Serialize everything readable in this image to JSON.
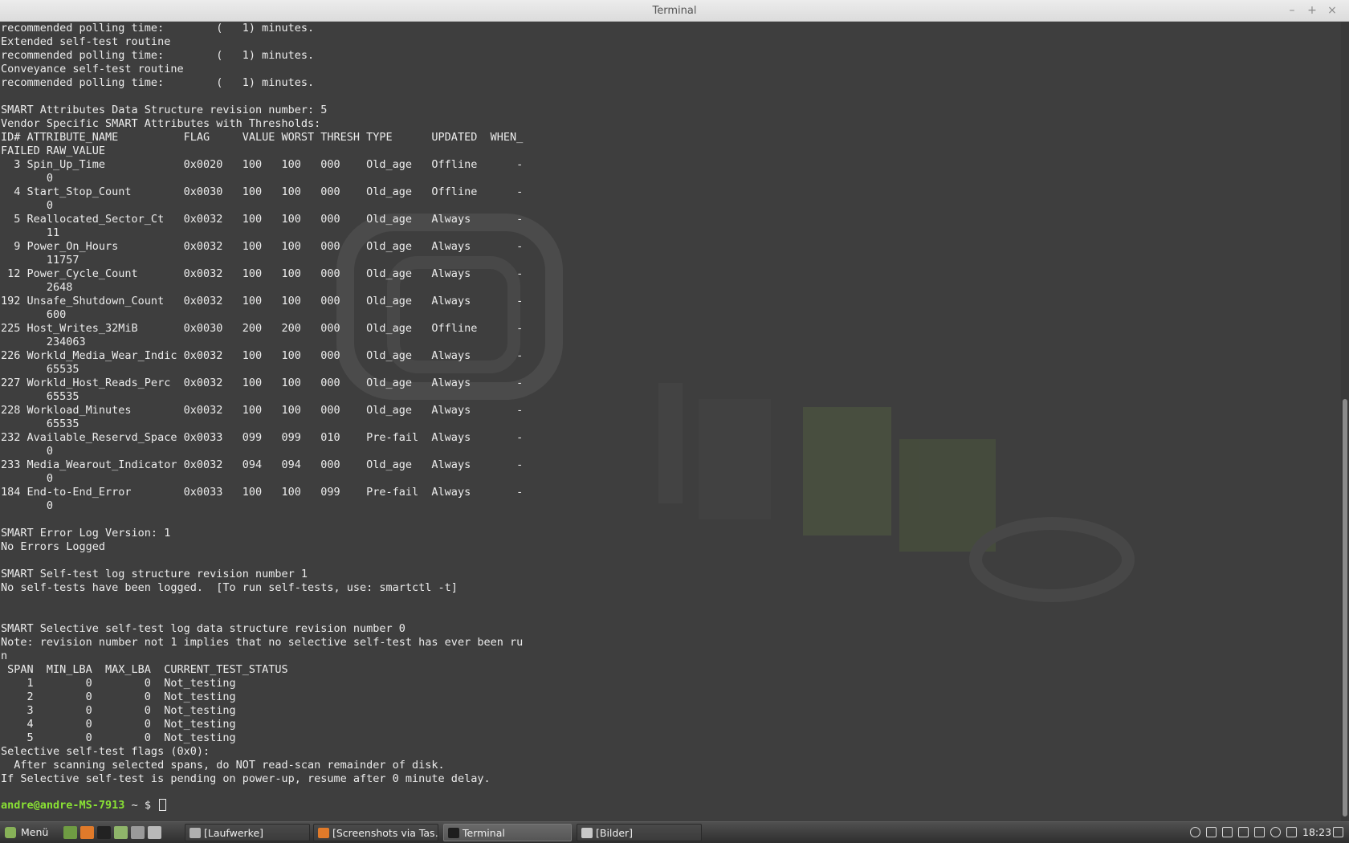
{
  "window": {
    "title": "Terminal",
    "minimize_glyph": "–",
    "maximize_glyph": "+",
    "close_glyph": "×"
  },
  "terminal": {
    "output_lines": [
      "recommended polling time:        (   1) minutes.",
      "Extended self-test routine",
      "recommended polling time:        (   1) minutes.",
      "Conveyance self-test routine",
      "recommended polling time:        (   1) minutes.",
      "",
      "SMART Attributes Data Structure revision number: 5",
      "Vendor Specific SMART Attributes with Thresholds:",
      "ID# ATTRIBUTE_NAME          FLAG     VALUE WORST THRESH TYPE      UPDATED  WHEN_",
      "FAILED RAW_VALUE",
      "  3 Spin_Up_Time            0x0020   100   100   000    Old_age   Offline      -",
      "       0",
      "  4 Start_Stop_Count        0x0030   100   100   000    Old_age   Offline      -",
      "       0",
      "  5 Reallocated_Sector_Ct   0x0032   100   100   000    Old_age   Always       -",
      "       11",
      "  9 Power_On_Hours          0x0032   100   100   000    Old_age   Always       -",
      "       11757",
      " 12 Power_Cycle_Count       0x0032   100   100   000    Old_age   Always       -",
      "       2648",
      "192 Unsafe_Shutdown_Count   0x0032   100   100   000    Old_age   Always       -",
      "       600",
      "225 Host_Writes_32MiB       0x0030   200   200   000    Old_age   Offline      -",
      "       234063",
      "226 Workld_Media_Wear_Indic 0x0032   100   100   000    Old_age   Always       -",
      "       65535",
      "227 Workld_Host_Reads_Perc  0x0032   100   100   000    Old_age   Always       -",
      "       65535",
      "228 Workload_Minutes        0x0032   100   100   000    Old_age   Always       -",
      "       65535",
      "232 Available_Reservd_Space 0x0033   099   099   010    Pre-fail  Always       -",
      "       0",
      "233 Media_Wearout_Indicator 0x0032   094   094   000    Old_age   Always       -",
      "       0",
      "184 End-to-End_Error        0x0033   100   100   099    Pre-fail  Always       -",
      "       0",
      "",
      "SMART Error Log Version: 1",
      "No Errors Logged",
      "",
      "SMART Self-test log structure revision number 1",
      "No self-tests have been logged.  [To run self-tests, use: smartctl -t]",
      "",
      "",
      "SMART Selective self-test log data structure revision number 0",
      "Note: revision number not 1 implies that no selective self-test has ever been ru",
      "n",
      " SPAN  MIN_LBA  MAX_LBA  CURRENT_TEST_STATUS",
      "    1        0        0  Not_testing",
      "    2        0        0  Not_testing",
      "    3        0        0  Not_testing",
      "    4        0        0  Not_testing",
      "    5        0        0  Not_testing",
      "Selective self-test flags (0x0):",
      "  After scanning selected spans, do NOT read-scan remainder of disk.",
      "If Selective self-test is pending on power-up, resume after 0 minute delay."
    ],
    "prompt": {
      "user_host": "andre@andre-MS-7913",
      "path_symbol": " ~ $ "
    }
  },
  "taskbar": {
    "menu_label": "Menü",
    "launchers": [
      {
        "name": "show-desktop-icon",
        "color": "#6f9c43"
      },
      {
        "name": "firefox-icon",
        "color": "#e07a2a"
      },
      {
        "name": "terminal-launcher-icon",
        "color": "#222222"
      },
      {
        "name": "files-icon",
        "color": "#8fb56a"
      },
      {
        "name": "system-tools-icon",
        "color": "#9a9a9a"
      },
      {
        "name": "screenshot-icon",
        "color": "#b9b9b9"
      }
    ],
    "tasks": [
      {
        "label": "[Laufwerke]",
        "icon": "disks-icon",
        "active": false
      },
      {
        "label": "[Screenshots via Tas…",
        "icon": "firefox-icon",
        "active": false
      },
      {
        "label": "Terminal",
        "icon": "terminal-icon",
        "active": true
      },
      {
        "label": "[Bilder]",
        "icon": "folder-icon",
        "active": false
      }
    ],
    "tray": [
      "user-icon",
      "updates-icon",
      "bluetooth-icon",
      "wifi-icon",
      "volume-icon",
      "brightness-icon",
      "shield-icon",
      "display-icon"
    ],
    "clock": "18:23"
  },
  "colors": {
    "terminal_bg": "#3e3e3e",
    "text": "#ececec",
    "prompt_green": "#8ae234",
    "accent_mint": "#87b158"
  }
}
